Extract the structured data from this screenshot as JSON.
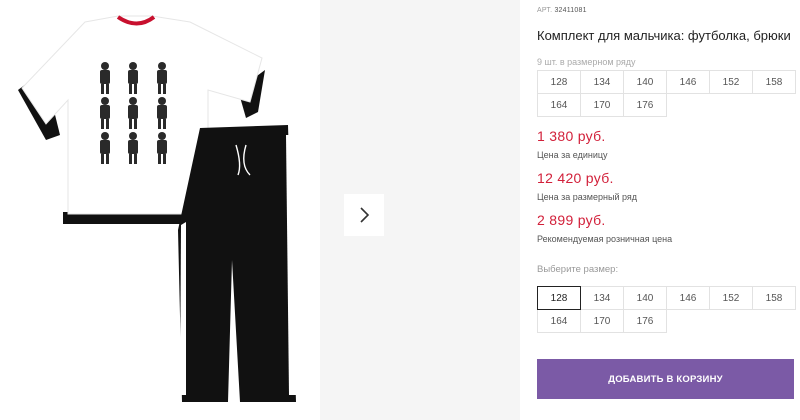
{
  "product": {
    "article_label": "АРТ.",
    "article_number": "32411081",
    "title": "Комплект для мальчика: футболка, брюки"
  },
  "size_row": {
    "note": "9 шт. в размерном ряду",
    "sizes": [
      "128",
      "134",
      "140",
      "146",
      "152",
      "158",
      "164",
      "170",
      "176"
    ]
  },
  "prices": {
    "unit_price": "1 380 руб.",
    "unit_label": "Цена за единицу",
    "row_price": "12 420 руб.",
    "row_label": "Цена за размерный ряд",
    "retail_price": "2 899 руб.",
    "retail_label": "Рекомендуемая розничная цена"
  },
  "size_select": {
    "label": "Выберите размер:",
    "selected": "128",
    "sizes": [
      "128",
      "134",
      "140",
      "146",
      "152",
      "158",
      "164",
      "170",
      "176"
    ]
  },
  "cart_button": "ДОБАВИТЬ В КОРЗИНУ",
  "gallery": {
    "next_icon": "chevron-right-icon"
  },
  "colors": {
    "accent": "#7b5aa6",
    "price": "#d2203a"
  }
}
